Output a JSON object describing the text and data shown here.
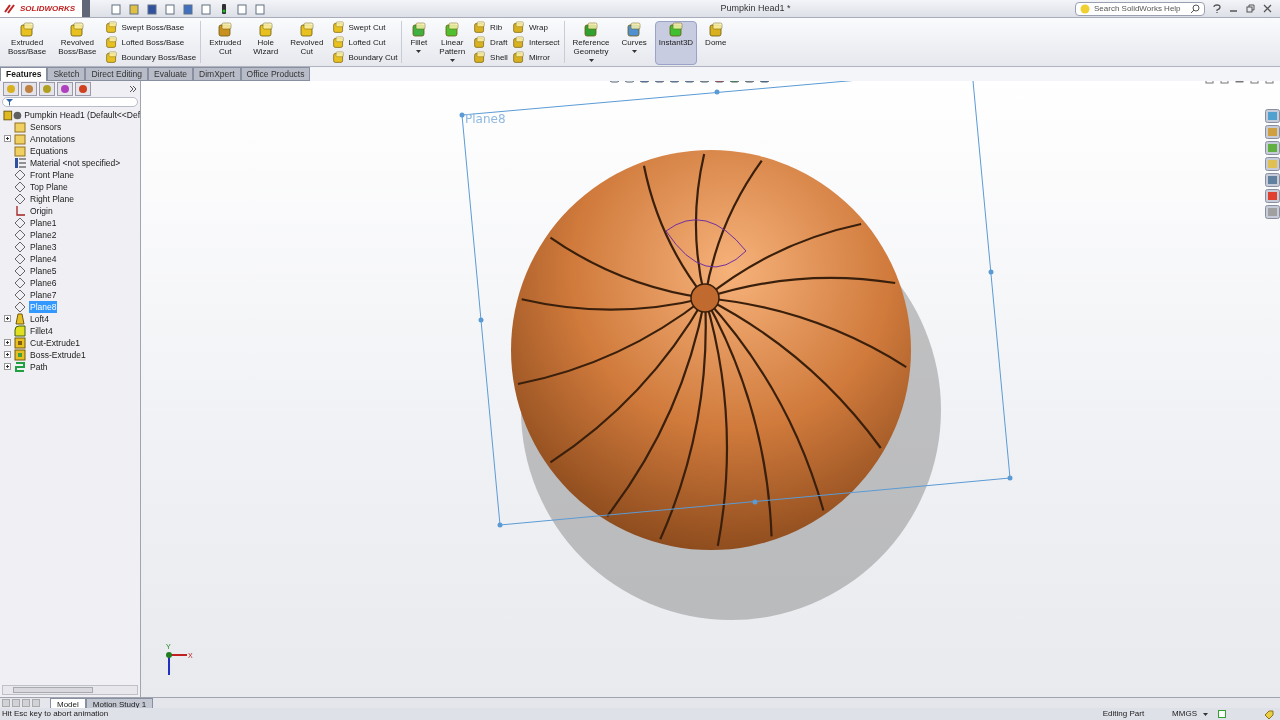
{
  "app": {
    "logo": "SOLIDWORKS",
    "document_title": "Pumpkin Head1 *",
    "search_placeholder": "Search SolidWorks Help"
  },
  "ribbon": [
    {
      "kind": "large",
      "label": "Extruded\nBoss/Base",
      "dropdown": false
    },
    {
      "kind": "large",
      "label": "Revolved\nBoss/Base",
      "dropdown": false
    },
    {
      "kind": "column",
      "items": [
        {
          "label": "Swept Boss/Base"
        },
        {
          "label": "Lofted Boss/Base"
        },
        {
          "label": "Boundary Boss/Base"
        }
      ]
    },
    {
      "kind": "separator"
    },
    {
      "kind": "large",
      "label": "Extruded\nCut",
      "dropdown": false
    },
    {
      "kind": "large",
      "label": "Hole\nWizard",
      "dropdown": false
    },
    {
      "kind": "large",
      "label": "Revolved\nCut",
      "dropdown": false
    },
    {
      "kind": "column",
      "items": [
        {
          "label": "Swept Cut"
        },
        {
          "label": "Lofted Cut"
        },
        {
          "label": "Boundary Cut"
        }
      ]
    },
    {
      "kind": "separator"
    },
    {
      "kind": "large",
      "label": "Fillet",
      "dropdown": true
    },
    {
      "kind": "large",
      "label": "Linear\nPattern",
      "dropdown": true
    },
    {
      "kind": "column",
      "items": [
        {
          "label": "Rib"
        },
        {
          "label": "Draft"
        },
        {
          "label": "Shell"
        }
      ]
    },
    {
      "kind": "column",
      "items": [
        {
          "label": "Wrap"
        },
        {
          "label": "Intersect"
        },
        {
          "label": "Mirror"
        }
      ]
    },
    {
      "kind": "separator"
    },
    {
      "kind": "large",
      "label": "Reference\nGeometry",
      "dropdown": true
    },
    {
      "kind": "large",
      "label": "Curves",
      "dropdown": true
    },
    {
      "kind": "large",
      "label": "Instant3D",
      "dropdown": false,
      "selected": true
    },
    {
      "kind": "large",
      "label": "Dome",
      "dropdown": false,
      "selected": false
    }
  ],
  "command_tabs": [
    {
      "label": "Features",
      "selected": true
    },
    {
      "label": "Sketch",
      "selected": false
    },
    {
      "label": "Direct Editing",
      "selected": false
    },
    {
      "label": "Evaluate",
      "selected": false
    },
    {
      "label": "DimXpert",
      "selected": false
    },
    {
      "label": "Office Products",
      "selected": false
    }
  ],
  "tree": {
    "label": "Pumpkin Head1  (Default<<Def",
    "children": [
      {
        "label": "Sensors",
        "kind": "sensor",
        "collapsible": false,
        "selected": false
      },
      {
        "label": "Annotations",
        "kind": "annotation",
        "collapsible": true,
        "selected": false
      },
      {
        "label": "Equations",
        "kind": "equation",
        "collapsible": false,
        "selected": false
      },
      {
        "label": "Material <not specified>",
        "kind": "material",
        "collapsible": false,
        "selected": false
      },
      {
        "label": "Front Plane",
        "kind": "plane",
        "collapsible": false,
        "selected": false
      },
      {
        "label": "Top Plane",
        "kind": "plane",
        "collapsible": false,
        "selected": false
      },
      {
        "label": "Right Plane",
        "kind": "plane",
        "collapsible": false,
        "selected": false
      },
      {
        "label": "Origin",
        "kind": "origin",
        "collapsible": false,
        "selected": false
      },
      {
        "label": "Plane1",
        "kind": "plane",
        "collapsible": false,
        "selected": false
      },
      {
        "label": "Plane2",
        "kind": "plane",
        "collapsible": false,
        "selected": false
      },
      {
        "label": "Plane3",
        "kind": "plane",
        "collapsible": false,
        "selected": false
      },
      {
        "label": "Plane4",
        "kind": "plane",
        "collapsible": false,
        "selected": false
      },
      {
        "label": "Plane5",
        "kind": "plane",
        "collapsible": false,
        "selected": false
      },
      {
        "label": "Plane6",
        "kind": "plane",
        "collapsible": false,
        "selected": false
      },
      {
        "label": "Plane7",
        "kind": "plane",
        "collapsible": false,
        "selected": false
      },
      {
        "label": "Plane8",
        "kind": "plane",
        "collapsible": false,
        "selected": true
      },
      {
        "label": "Loft4",
        "kind": "loft",
        "collapsible": true,
        "selected": false
      },
      {
        "label": "Fillet4",
        "kind": "fillet",
        "collapsible": false,
        "selected": false
      },
      {
        "label": "Cut-Extrude1",
        "kind": "cut",
        "collapsible": true,
        "selected": false
      },
      {
        "label": "Boss-Extrude1",
        "kind": "boss",
        "collapsible": true,
        "selected": false
      },
      {
        "label": "Path",
        "kind": "path",
        "collapsible": true,
        "selected": false
      }
    ]
  },
  "viewport": {
    "plane_label": "Plane8",
    "axis_labels": [
      "X",
      "Y"
    ]
  },
  "bottom_tabs": [
    {
      "label": "Model",
      "selected": true
    },
    {
      "label": "Motion Study 1",
      "selected": false
    }
  ],
  "status_bar": {
    "message": "Hit Esc key to abort animation",
    "mode": "Editing Part",
    "units": "MMGS"
  }
}
